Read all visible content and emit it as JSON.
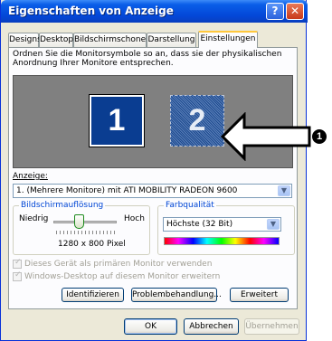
{
  "window": {
    "title": "Eigenschaften von Anzeige",
    "help_glyph": "?",
    "close_glyph": "✕"
  },
  "tabs": [
    {
      "label": "Designs"
    },
    {
      "label": "Desktop"
    },
    {
      "label": "Bildschirmschoner"
    },
    {
      "label": "Darstellung"
    },
    {
      "label": "Einstellungen",
      "active": true
    }
  ],
  "instructions": "Ordnen Sie die Monitorsymbole so an, dass sie der physikalischen Anordnung Ihrer Monitore entsprechen.",
  "monitors": [
    {
      "number": "1",
      "selected": true
    },
    {
      "number": "2",
      "selected": false
    }
  ],
  "callout": {
    "number": "1",
    "glyph": "❶"
  },
  "display": {
    "label": "Anzeige:",
    "value": "1. (Mehrere Monitore) mit ATI MOBILITY RADEON 9600"
  },
  "resolution": {
    "title": "Bildschirmauflösung",
    "low": "Niedrig",
    "high": "Hoch",
    "value": "1280 x 800 Pixel",
    "slider_level_fraction": 0.33
  },
  "color_quality": {
    "title": "Farbqualität",
    "value": "Höchste (32 Bit)"
  },
  "checkboxes": [
    {
      "label": "Dieses Gerät als primären Monitor verwenden",
      "checked": true,
      "enabled": false
    },
    {
      "label": "Windows-Desktop auf diesem Monitor erweitern",
      "checked": true,
      "enabled": false
    }
  ],
  "panel_buttons": {
    "identify": "Identifizieren",
    "troubleshoot": "Problembehandlung...",
    "advanced": "Erweitert"
  },
  "dialog_buttons": {
    "ok": "OK",
    "cancel": "Abbrechen",
    "apply": "Übernehmen"
  },
  "colors": {
    "titlebar": "#0a5ee8",
    "monitor_area": "#808080",
    "monitor_selected": "#0a3d91",
    "group_title": "#0046d5"
  }
}
